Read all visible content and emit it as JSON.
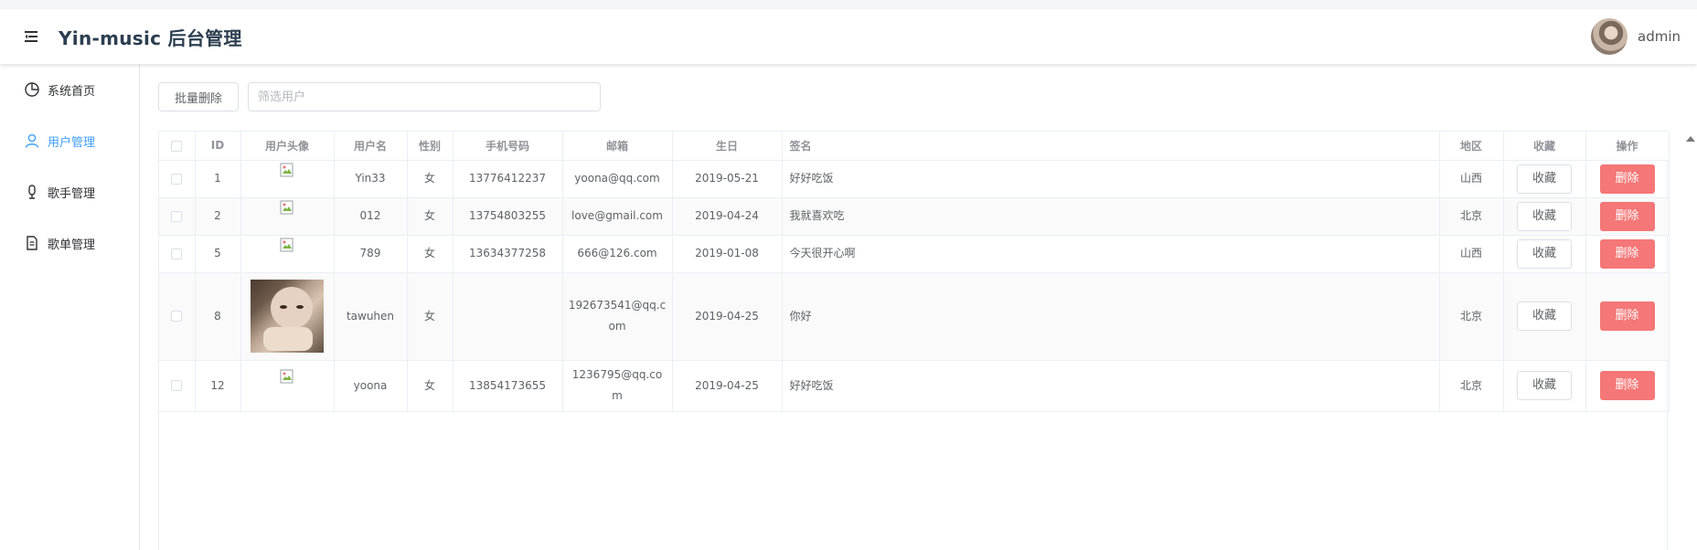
{
  "app": {
    "title": "Yin-music 后台管理"
  },
  "header": {
    "username": "admin"
  },
  "sidebar": {
    "items": [
      {
        "label": "系统首页",
        "icon": "pie-chart-icon",
        "active": false
      },
      {
        "label": "用户管理",
        "icon": "user-icon",
        "active": true
      },
      {
        "label": "歌手管理",
        "icon": "microphone-icon",
        "active": false
      },
      {
        "label": "歌单管理",
        "icon": "document-icon",
        "active": false
      }
    ]
  },
  "toolbar": {
    "batch_delete_label": "批量删除",
    "search_placeholder": "筛选用户",
    "search_value": ""
  },
  "table": {
    "columns": [
      "ID",
      "用户头像",
      "用户名",
      "性别",
      "手机号码",
      "邮箱",
      "生日",
      "签名",
      "地区",
      "收藏",
      "操作"
    ],
    "fav_label": "收藏",
    "delete_label": "删除",
    "rows": [
      {
        "id": "1",
        "avatar": "broken",
        "username": "Yin33",
        "sex": "女",
        "phone": "13776412237",
        "email": "yoona@qq.com",
        "birth": "2019-05-21",
        "signature": "好好吃饭",
        "location": "山西"
      },
      {
        "id": "2",
        "avatar": "broken",
        "username": "012",
        "sex": "女",
        "phone": "13754803255",
        "email": "love@gmail.com",
        "birth": "2019-04-24",
        "signature": "我就喜欢吃",
        "location": "北京"
      },
      {
        "id": "5",
        "avatar": "broken",
        "username": "789",
        "sex": "女",
        "phone": "13634377258",
        "email": "666@126.com",
        "birth": "2019-01-08",
        "signature": "今天很开心啊",
        "location": "山西"
      },
      {
        "id": "8",
        "avatar": "photo",
        "username": "tawuhen",
        "sex": "女",
        "phone": "",
        "email": "192673541@qq.com",
        "birth": "2019-04-25",
        "signature": "你好",
        "location": "北京"
      },
      {
        "id": "12",
        "avatar": "broken",
        "username": "yoona",
        "sex": "女",
        "phone": "13854173655",
        "email": "1236795@qq.com",
        "birth": "2019-04-25",
        "signature": "好好吃饭",
        "location": "北京"
      }
    ]
  },
  "colors": {
    "accent": "#409eff",
    "danger": "#f56c6c",
    "title": "#2c3e50"
  }
}
